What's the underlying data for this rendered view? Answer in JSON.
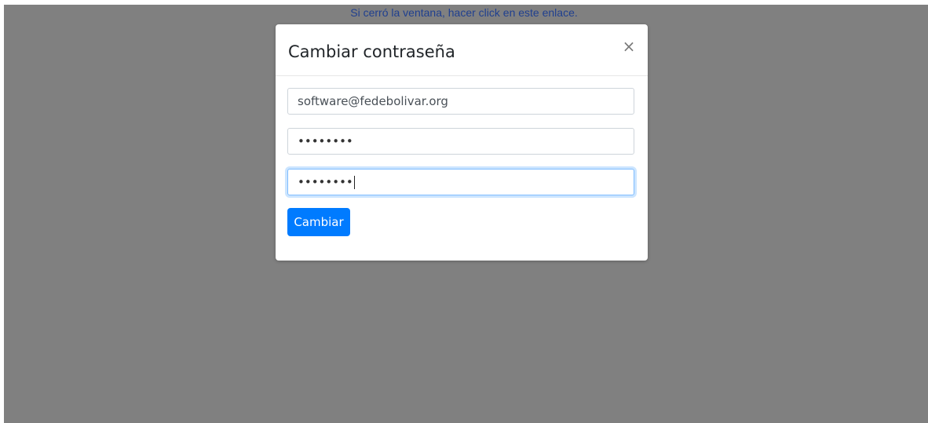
{
  "page": {
    "reopen_link": "Si cerró la ventana, hacer click en este enlace."
  },
  "modal": {
    "title": "Cambiar contraseña",
    "close_symbol": "×",
    "email_value": "software@fedebolivar.org",
    "password_value": "••••••••",
    "password_confirm_value": "••••••••",
    "submit_label": "Cambiar"
  },
  "colors": {
    "backdrop": "#808080",
    "primary_button": "#007bff",
    "link": "#1f3f8f",
    "focus_border": "#80bdff"
  }
}
